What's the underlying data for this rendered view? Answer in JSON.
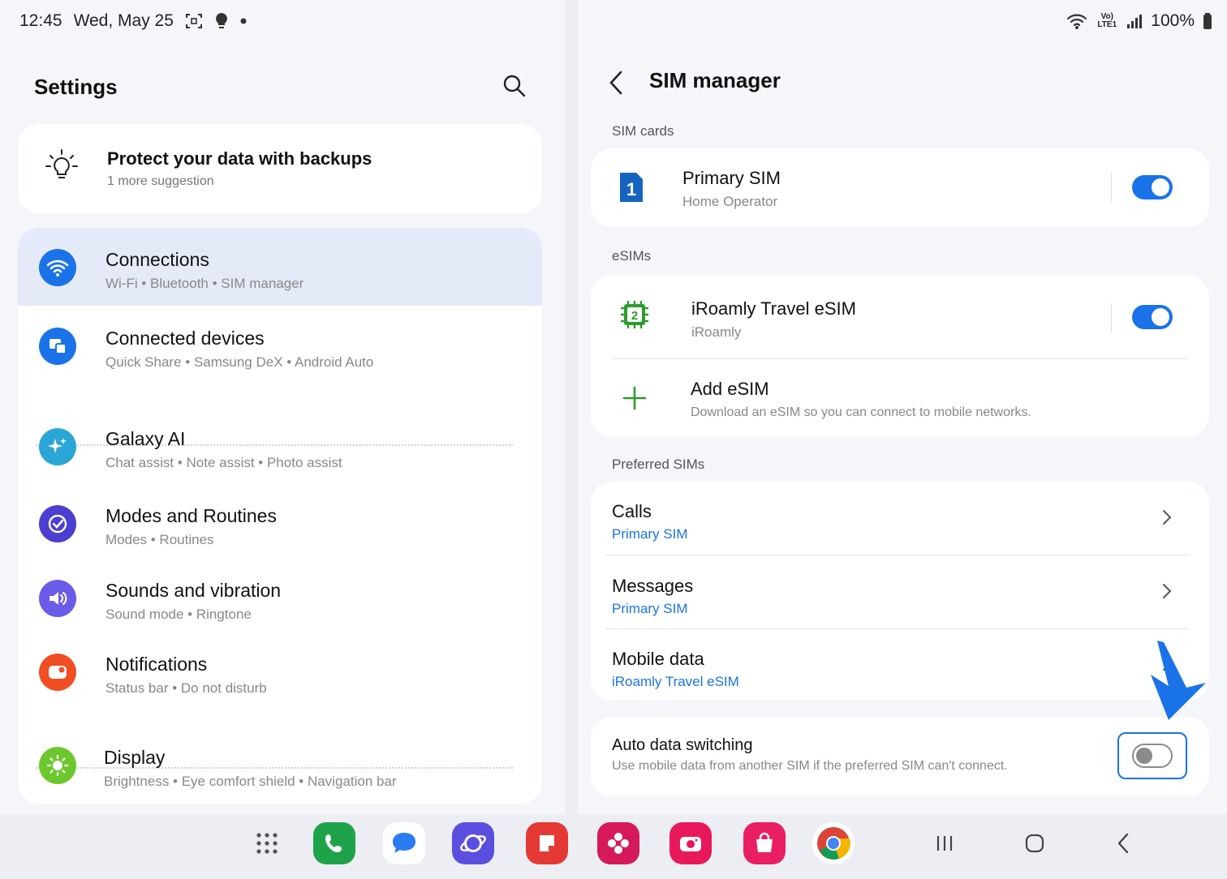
{
  "status": {
    "time": "12:45",
    "date": "Wed, May 25",
    "battery": "100%",
    "net": "Vo) LTE1"
  },
  "settings": {
    "title": "Settings",
    "suggestion": {
      "title": "Protect your data with backups",
      "sub": "1 more suggestion"
    },
    "items": [
      {
        "title": "Connections",
        "sub": "Wi-Fi  •  Bluetooth  •  SIM manager",
        "icon": "wifi-icon",
        "color": "#1a73e8"
      },
      {
        "title": "Connected devices",
        "sub": "Quick Share  •  Samsung DeX  •  Android Auto",
        "icon": "connected-devices-icon",
        "color": "#1a73e8"
      },
      {
        "title": "Galaxy AI",
        "sub": "Chat assist  •  Note assist  •  Photo assist",
        "icon": "galaxy-ai-icon",
        "color": "#2aa6d6"
      },
      {
        "title": "Modes and Routines",
        "sub": "Modes  •  Routines",
        "icon": "modes-icon",
        "color": "#4a3fd1"
      },
      {
        "title": "Sounds and vibration",
        "sub": "Sound mode  •  Ringtone",
        "icon": "sound-icon",
        "color": "#6a5be8"
      },
      {
        "title": "Notifications",
        "sub": "Status bar  •  Do not disturb",
        "icon": "notification-icon",
        "color": "#f04e23"
      },
      {
        "title": "Display",
        "sub": "Brightness  •  Eye comfort shield  •  Navigation bar",
        "icon": "display-icon",
        "color": "#6cc72c"
      }
    ]
  },
  "sim": {
    "title": "SIM manager",
    "sec_sim_cards": "SIM cards",
    "primary": {
      "title": "Primary SIM",
      "sub": "Home Operator",
      "enabled": true
    },
    "sec_esims": "eSIMs",
    "esim": {
      "title": "iRoamly Travel eSIM",
      "sub": "iRoamly",
      "enabled": true
    },
    "add": {
      "title": "Add eSIM",
      "sub": "Download an eSIM so you can connect to mobile networks."
    },
    "sec_preferred": "Preferred SIMs",
    "calls": {
      "title": "Calls",
      "value": "Primary SIM"
    },
    "messages": {
      "title": "Messages",
      "value": "Primary SIM"
    },
    "mobile_data": {
      "title": "Mobile data",
      "value": "iRoamly Travel eSIM"
    },
    "auto": {
      "title": "Auto data switching",
      "sub": "Use mobile data from another SIM if the preferred SIM can't connect.",
      "enabled": false
    }
  },
  "colors": {
    "accent": "#1a73e8",
    "bg": "#f5f6fa",
    "card": "#ffffff"
  }
}
